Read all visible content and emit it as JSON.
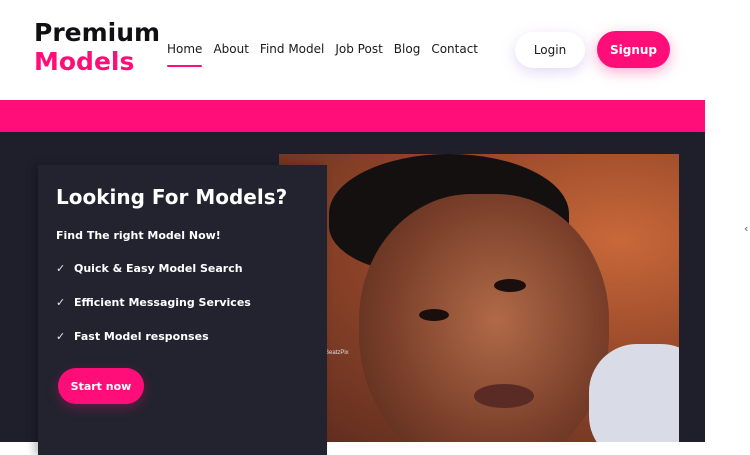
{
  "logo": {
    "line1": "Premium",
    "line2": "Models"
  },
  "nav": {
    "items": [
      "Home",
      "About",
      "Find Model",
      "Job Post",
      "Blog",
      "Contact"
    ],
    "active": "Home"
  },
  "auth": {
    "login_label": "Login",
    "signup_label": "Signup"
  },
  "hero": {
    "title": "Looking For Models?",
    "subtitle": "Find The right Model Now!",
    "features": [
      "Quick & Easy Model Search",
      "Efficient Messaging Services",
      "Fast Model responses"
    ],
    "cta_label": "Start now",
    "image_watermark": "BeatzPix"
  },
  "side_control": {
    "arrow": "‹"
  },
  "colors": {
    "accent": "#ff0e79",
    "dark_bg": "#1e1f2b",
    "card_bg": "#22232f",
    "header_bg": "#ffffff"
  }
}
